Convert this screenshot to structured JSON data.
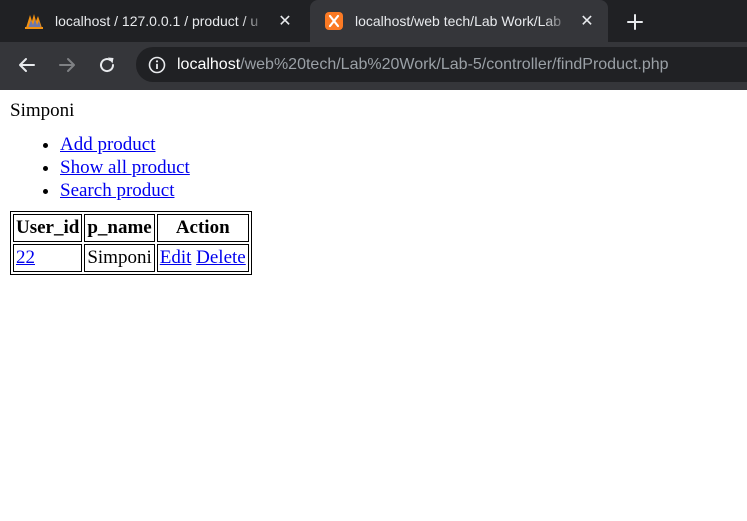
{
  "browser": {
    "tabs": [
      {
        "title": "localhost / 127.0.0.1 / product / u",
        "favicon": "phpmyadmin-icon",
        "active": false
      },
      {
        "title": "localhost/web tech/Lab Work/Lab",
        "favicon": "xampp-icon",
        "active": true
      }
    ],
    "address_bar": {
      "host": "localhost",
      "path": "/web%20tech/Lab%20Work/Lab-5/controller/findProduct.php"
    }
  },
  "page": {
    "heading": "Simponi",
    "nav": [
      {
        "label": "Add product"
      },
      {
        "label": "Show all product"
      },
      {
        "label": "Search product"
      }
    ],
    "table": {
      "headers": [
        "User_id",
        "p_name",
        "Action"
      ],
      "rows": [
        {
          "user_id": "22",
          "p_name": "Simponi",
          "edit_label": "Edit",
          "delete_label": "Delete"
        }
      ]
    }
  },
  "colors": {
    "chrome_dark": "#202124",
    "chrome_toolbar": "#35363a",
    "link": "#0000ee",
    "xampp_orange": "#fb7a24"
  }
}
